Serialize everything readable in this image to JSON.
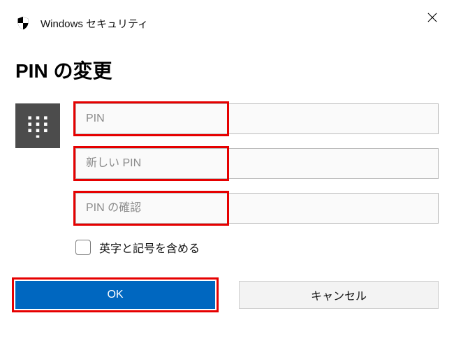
{
  "header": {
    "title": "Windows セキュリティ"
  },
  "heading": "PIN の変更",
  "fields": {
    "current_pin_placeholder": "PIN",
    "new_pin_placeholder": "新しい PIN",
    "confirm_pin_placeholder": "PIN の確認",
    "include_symbols_label": "英字と記号を含める"
  },
  "buttons": {
    "ok": "OK",
    "cancel": "キャンセル"
  }
}
